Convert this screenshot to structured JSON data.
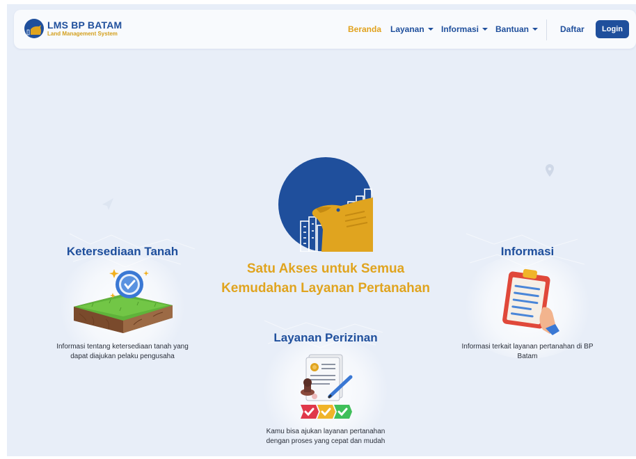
{
  "brand": {
    "title": "LMS BP BATAM",
    "subtitle": "Land Management System"
  },
  "nav": {
    "items": [
      {
        "label": "Beranda",
        "active": true,
        "dropdown": false
      },
      {
        "label": "Layanan",
        "active": false,
        "dropdown": true
      },
      {
        "label": "Informasi",
        "active": false,
        "dropdown": true
      },
      {
        "label": "Bantuan",
        "active": false,
        "dropdown": true
      }
    ],
    "register_label": "Daftar",
    "login_label": "Login"
  },
  "hero": {
    "line1": "Satu Akses untuk Semua",
    "line2": "Kemudahan Layanan Pertanahan"
  },
  "cards": {
    "land": {
      "title": "Ketersediaan Tanah",
      "desc_line1": "Informasi tentang ketersediaan tanah yang",
      "desc_line2": "dapat diajukan pelaku pengusaha",
      "icon": "land-plot-badge-icon"
    },
    "permit": {
      "title": "Layanan Perizinan",
      "desc_line1": "Kamu bisa ajukan layanan pertanahan",
      "desc_line2": "dengan proses yang cepat dan mudah",
      "icon": "permit-document-icon"
    },
    "info": {
      "title": "Informasi",
      "desc_line1": "Informasi terkait layanan pertanahan di BP",
      "desc_line2": "Batam",
      "icon": "clipboard-icon"
    }
  },
  "colors": {
    "primary": "#1f4f9c",
    "accent": "#e0a41f",
    "background": "#e8eef8",
    "navbar": "#f8fafd"
  }
}
